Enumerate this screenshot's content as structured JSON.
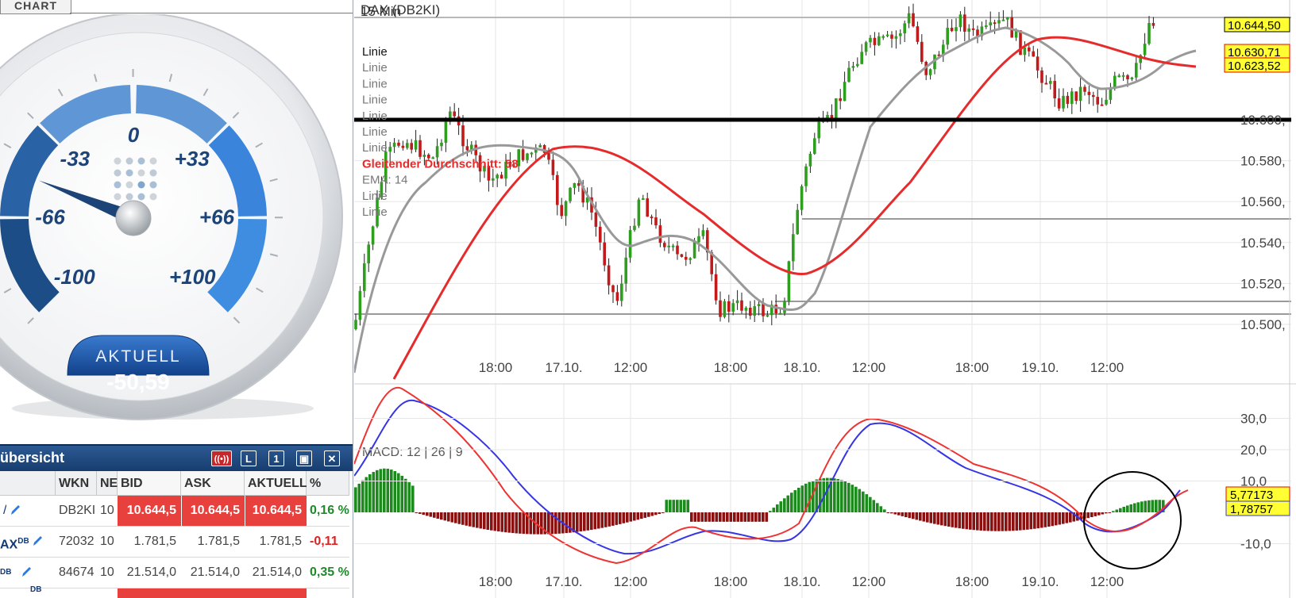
{
  "tab": {
    "label": "CHART"
  },
  "gauge": {
    "labels": [
      "-100",
      "-66",
      "-33",
      "0",
      "+33",
      "+66",
      "+100"
    ],
    "value": -50.59,
    "current_label": "AKTUELL",
    "current_value": "-50,59",
    "colors": {
      "dark": "#1c4d86",
      "light": "#3f8de0",
      "badge": "#184f9c"
    }
  },
  "overview": {
    "title": "übersicht",
    "buttons": [
      "L",
      "1"
    ],
    "columns": [
      "WKN",
      "NE",
      "BID",
      "ASK",
      "AKTUELL",
      "%"
    ],
    "rows": [
      {
        "name": "",
        "wkn": "DB2KI",
        "ne": "10",
        "bid": "10.644,5",
        "ask": "10.644,5",
        "aktuell": "10.644,5",
        "pct": "0,16 %",
        "highlight": true,
        "up": true
      },
      {
        "name": "AX",
        "sup": "DB",
        "wkn": "72032",
        "ne": "10",
        "bid": "1.781,5",
        "ask": "1.781,5",
        "aktuell": "1.781,5",
        "pct": "-0,11",
        "highlight": false,
        "up": false
      },
      {
        "name": "",
        "sup": "DB",
        "wkn": "84674",
        "ne": "10",
        "bid": "21.514,0",
        "ask": "21.514,0",
        "aktuell": "21.514,0",
        "pct": "0,35 %",
        "highlight": false,
        "up": true
      }
    ],
    "partial_row": {
      "sup": "DB"
    }
  },
  "chart": {
    "header_text": "DAX (DB2KI)",
    "interval": "15 Min",
    "legend": [
      "Linie",
      "Linie",
      "Linie",
      "Linie",
      "Linie",
      "Linie",
      "Linie",
      "Gleitender Durchschnitt: 58",
      "EMA: 14",
      "Linie",
      "Linie"
    ],
    "y_labels": [
      "10.600,",
      "10.580,",
      "10.560,",
      "10.540,",
      "10.520,",
      "10.500,"
    ],
    "x_labels": [
      "18:00",
      "17.10.",
      "12:00",
      "18:00",
      "18.10.",
      "12:00",
      "18:00",
      "19.10.",
      "12:00"
    ],
    "price_badges": [
      "10.644,50",
      "10.630,71",
      "10.623,52"
    ],
    "macd_label": "MACD: 12 | 26 | 9",
    "macd_y_labels": [
      "30,0",
      "20,0",
      "10,0",
      "-10,0"
    ],
    "macd_badges": [
      "5,77173",
      "1,78757"
    ],
    "colors": {
      "up": "#2e9e1e",
      "down": "#c21a1a",
      "ma": "#e52b2b",
      "ema": "#999999",
      "macd": "#3535e6",
      "signal": "#ee3333",
      "hist_pos": "#1d8a1d",
      "hist_neg": "#8b1010",
      "badge": "#ffff33"
    }
  },
  "chart_data": {
    "type": "line",
    "title": "DAX 15 Min",
    "x_ticks": [
      "18:00",
      "17.10.",
      "12:00",
      "18:00",
      "18.10.",
      "12:00",
      "18:00",
      "19.10.",
      "12:00"
    ],
    "ylim": [
      10490,
      10650
    ],
    "y_ticks": [
      10600,
      10580,
      10560,
      10540,
      10520,
      10500
    ],
    "last_price": 10644.5,
    "moving_average_58": 10623.52,
    "ema_14": 10630.71,
    "horizontal_line": 10600,
    "macd": {
      "params": "12 | 26 | 9",
      "ylim": [
        -15,
        35
      ],
      "y_ticks": [
        30,
        20,
        10,
        -10
      ],
      "macd_last": 5.77173,
      "signal_last": 1.78757
    }
  }
}
